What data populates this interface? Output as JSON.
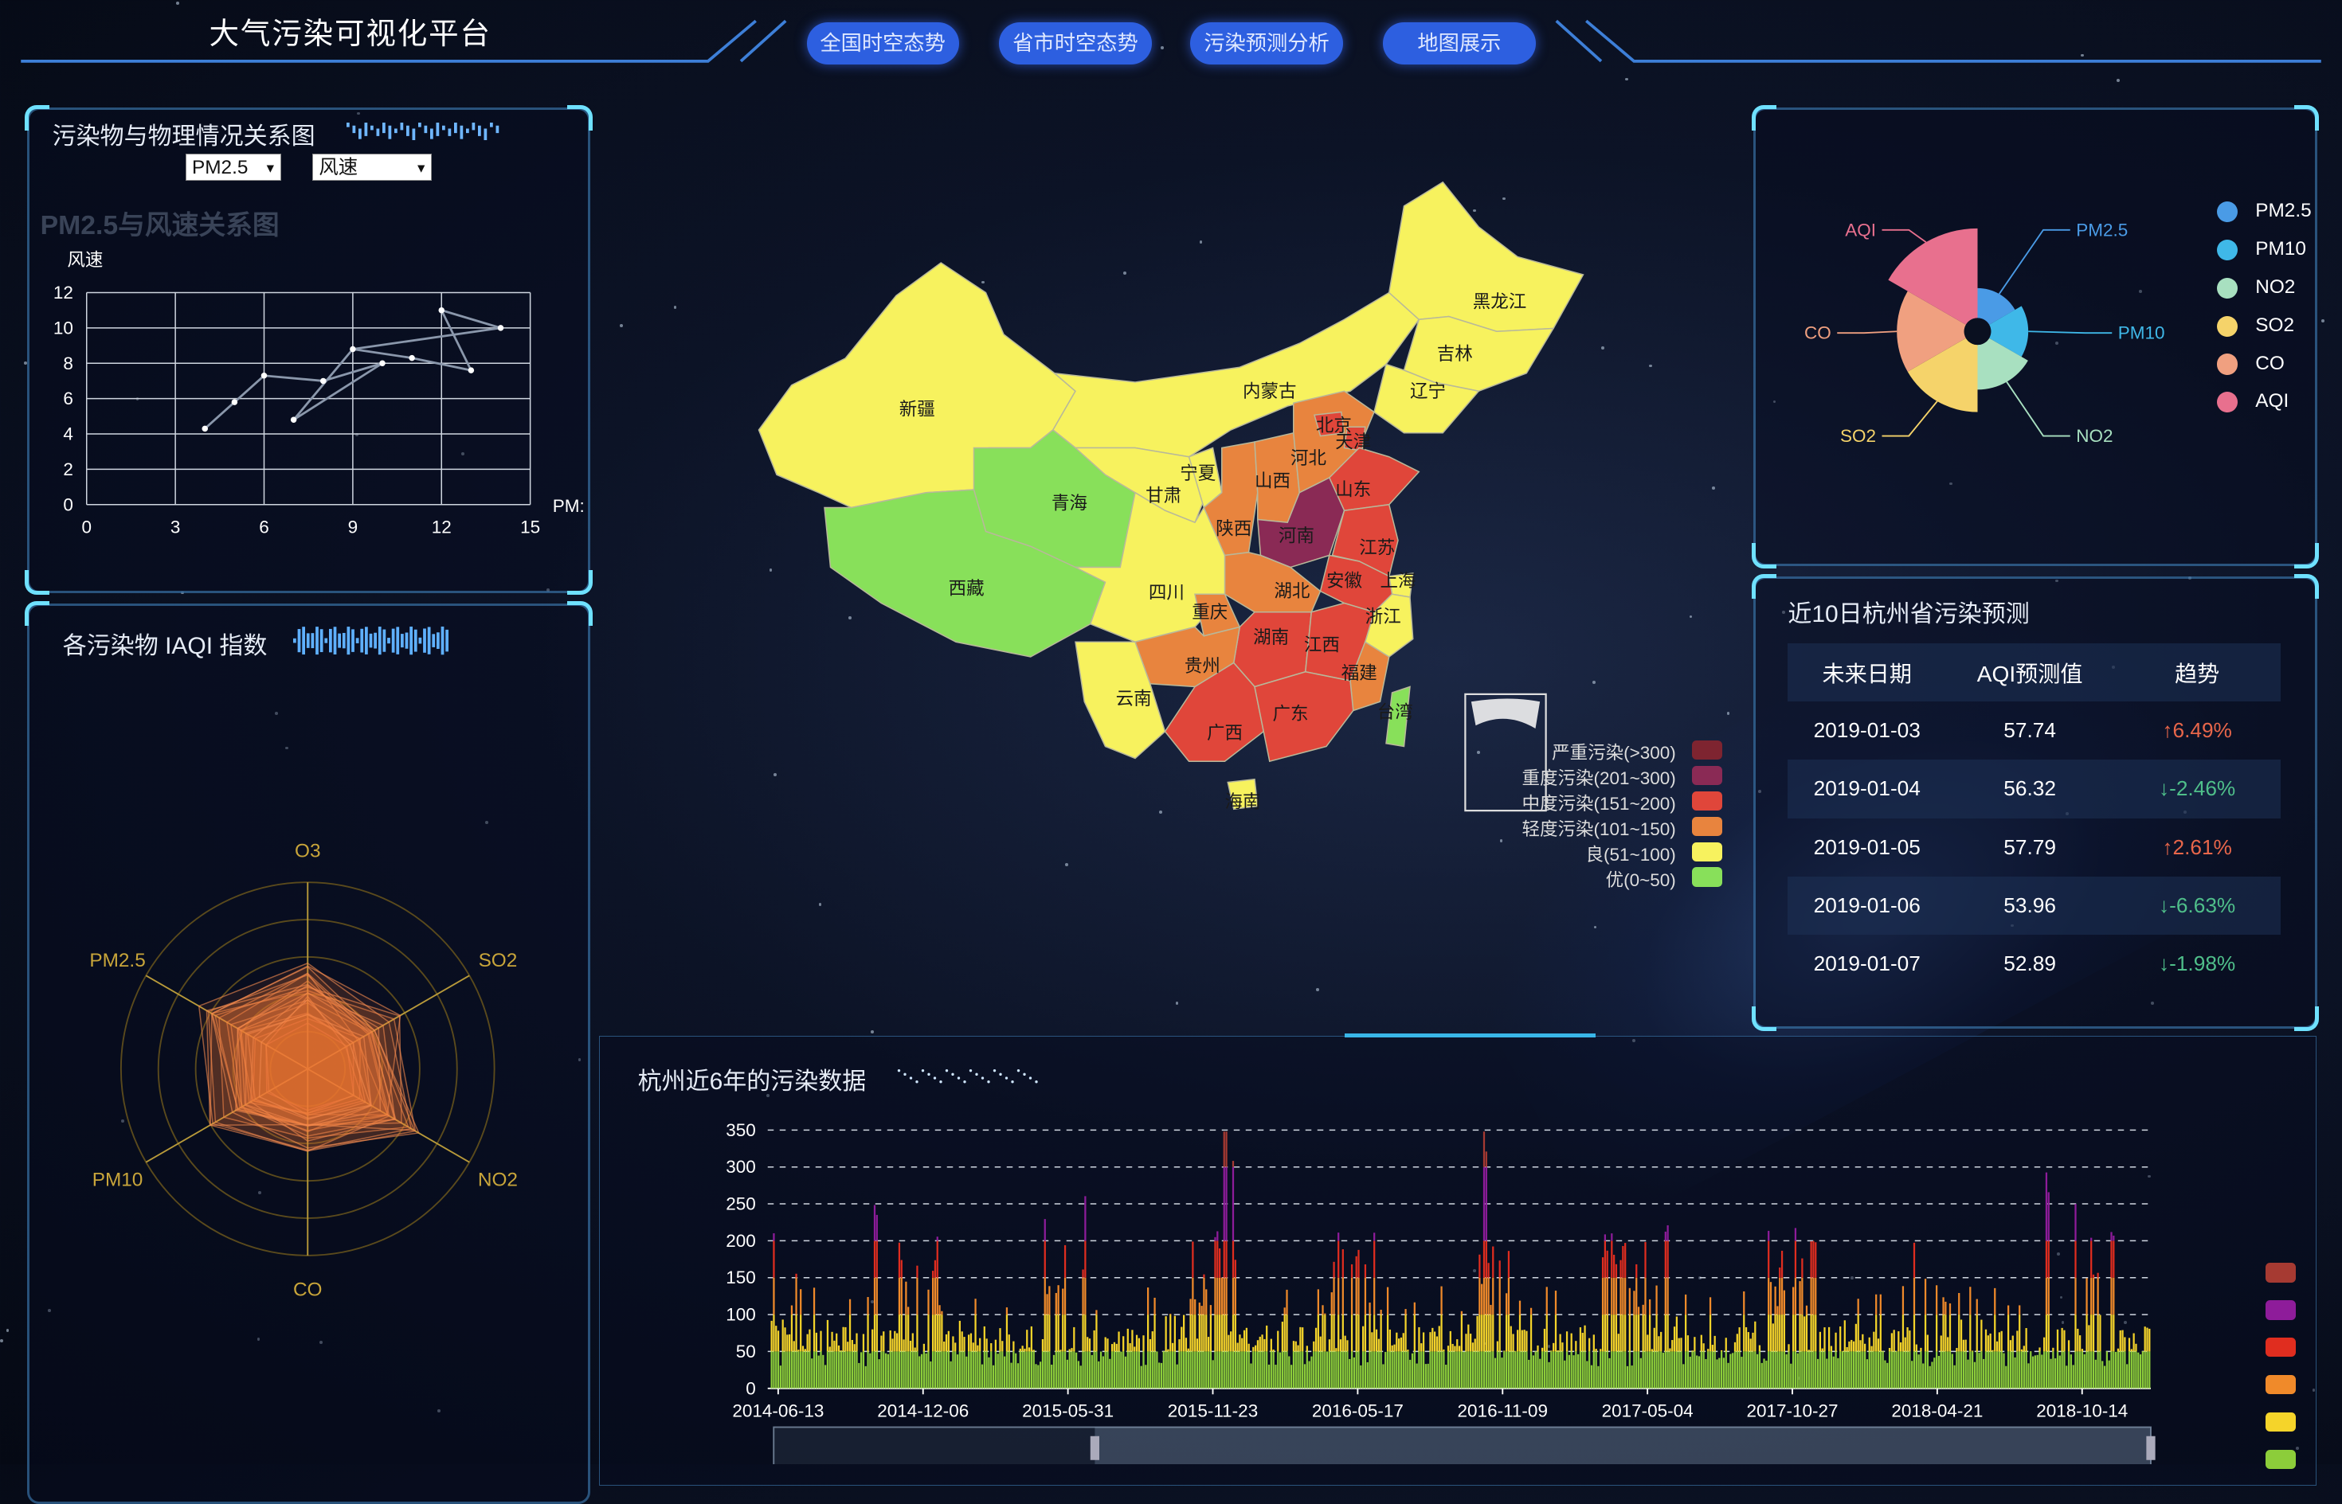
{
  "header": {
    "title": "大气污染可视化平台",
    "nav": [
      "全国时空态势",
      "省市时空态势",
      "污染预测分析",
      "地图展示"
    ]
  },
  "scatter_panel": {
    "title": "污染物与物理情况关系图",
    "select_pollutant": "PM2.5",
    "select_physical": "风速",
    "chart_title": "PM2.5与风速关系图",
    "ylabel": "风速",
    "xlabel": "PM:"
  },
  "radar_panel": {
    "title": "各污染物 IAQI 指数",
    "axes": [
      "O3",
      "SO2",
      "NO2",
      "CO",
      "PM10",
      "PM2.5"
    ]
  },
  "rose_panel": {
    "labels": [
      "PM2.5",
      "PM10",
      "NO2",
      "SO2",
      "CO",
      "AQI"
    ],
    "legend": [
      "PM2.5",
      "PM10",
      "NO2",
      "SO2",
      "CO",
      "AQI"
    ],
    "colors": [
      "#4a9be6",
      "#3fb8e8",
      "#a8e0c0",
      "#f5d36a",
      "#f0a080",
      "#e8708e"
    ]
  },
  "forecast_panel": {
    "title": "近10日杭州省污染预测",
    "headers": [
      "未来日期",
      "AQI预测值",
      "趋势"
    ],
    "rows": [
      {
        "date": "2019-01-03",
        "value": "57.74",
        "trend": "↑6.49%",
        "dir": "up"
      },
      {
        "date": "2019-01-04",
        "value": "56.32",
        "trend": "↓-2.46%",
        "dir": "down"
      },
      {
        "date": "2019-01-05",
        "value": "57.79",
        "trend": "↑2.61%",
        "dir": "up"
      },
      {
        "date": "2019-01-06",
        "value": "53.96",
        "trend": "↓-6.63%",
        "dir": "down"
      },
      {
        "date": "2019-01-07",
        "value": "52.89",
        "trend": "↓-1.98%",
        "dir": "down"
      }
    ]
  },
  "map": {
    "provinces": [
      "黑龙江",
      "吉林",
      "辽宁",
      "内蒙古",
      "北京",
      "天津",
      "河北",
      "山西",
      "山东",
      "宁夏",
      "甘肃",
      "陕西",
      "河南",
      "江苏",
      "安徽",
      "上海",
      "湖北",
      "浙江",
      "青海",
      "新疆",
      "西藏",
      "四川",
      "重庆",
      "湖南",
      "江西",
      "福建",
      "贵州",
      "云南",
      "广西",
      "广东",
      "台湾",
      "海南"
    ],
    "legend": [
      {
        "label": "严重污染(>300)",
        "color": "#7e2430"
      },
      {
        "label": "重度污染(201~300)",
        "color": "#8a2a55"
      },
      {
        "label": "中度污染(151~200)",
        "color": "#e0463a"
      },
      {
        "label": "轻度污染(101~150)",
        "color": "#e8843e"
      },
      {
        "label": "良(51~100)",
        "color": "#f7f25e"
      },
      {
        "label": "优(0~50)",
        "color": "#88e05a"
      }
    ]
  },
  "timeline_panel": {
    "title": "杭州近6年的污染数据",
    "legend_colors": [
      "#a63a32",
      "#8e1c9a",
      "#e02d1f",
      "#f08a2a",
      "#f5d42a",
      "#8ccd3a"
    ]
  },
  "chart_data": [
    {
      "type": "line",
      "title": "PM2.5与风速关系图",
      "ylabel": "风速",
      "xlabel": "PM:",
      "xlim": [
        0,
        15
      ],
      "ylim": [
        0,
        12
      ],
      "xticks": [
        0,
        3,
        6,
        9,
        12,
        15
      ],
      "yticks": [
        0,
        2,
        4,
        6,
        8,
        10,
        12
      ],
      "points": [
        [
          4,
          4.3
        ],
        [
          5,
          5.8
        ],
        [
          6,
          7.3
        ],
        [
          7,
          4.8
        ],
        [
          8,
          7
        ],
        [
          9,
          8.8
        ],
        [
          10,
          8
        ],
        [
          11,
          8.3
        ],
        [
          12,
          11
        ],
        [
          13,
          7.6
        ],
        [
          14,
          10
        ]
      ]
    },
    {
      "type": "radar",
      "axes": [
        "O3",
        "SO2",
        "NO2",
        "CO",
        "PM10",
        "PM2.5"
      ],
      "series": [
        {
          "values": [
            50,
            45,
            55,
            35,
            48,
            52
          ]
        },
        {
          "values": [
            40,
            38,
            42,
            30,
            36,
            40
          ]
        },
        {
          "values": [
            30,
            28,
            34,
            26,
            30,
            32
          ]
        }
      ]
    },
    {
      "type": "pie",
      "categories": [
        "PM2.5",
        "PM10",
        "NO2",
        "SO2",
        "CO",
        "AQI"
      ],
      "values": [
        20,
        25,
        30,
        45,
        45,
        60
      ]
    },
    {
      "type": "bar",
      "title": "杭州近6年的污染数据",
      "x_labels": [
        "2014-06-13",
        "2014-12-06",
        "2015-05-31",
        "2015-11-23",
        "2016-05-17",
        "2016-11-09",
        "2017-05-04",
        "2017-10-27",
        "2018-04-21",
        "2018-10-14"
      ],
      "ylim": [
        0,
        350
      ],
      "yticks": [
        0,
        50,
        100,
        150,
        200,
        250,
        300,
        350
      ],
      "color_bands": [
        {
          "max": 50,
          "color": "#8ccd3a"
        },
        {
          "max": 100,
          "color": "#f5d42a"
        },
        {
          "max": 150,
          "color": "#f08a2a"
        },
        {
          "max": 200,
          "color": "#e02d1f"
        },
        {
          "max": 300,
          "color": "#8e1c9a"
        },
        {
          "max": 350,
          "color": "#a63a32"
        }
      ],
      "peaks": [
        310,
        215,
        340,
        230,
        345,
        220,
        210,
        215,
        220
      ]
    }
  ]
}
